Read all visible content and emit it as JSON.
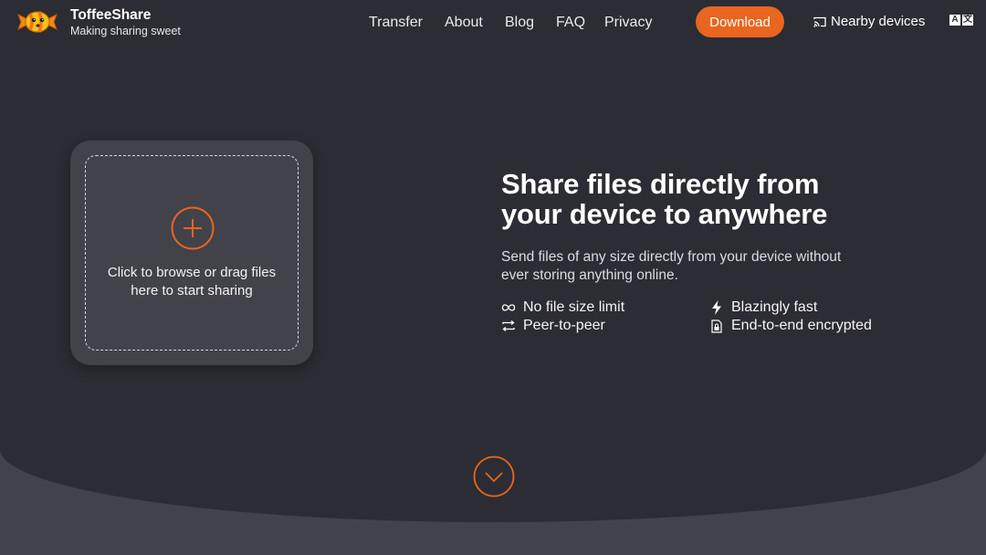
{
  "brand": {
    "name": "ToffeeShare",
    "tagline": "Making sharing sweet"
  },
  "nav": {
    "items": [
      {
        "label": "Transfer"
      },
      {
        "label": "About"
      },
      {
        "label": "Blog"
      },
      {
        "label": "FAQ"
      },
      {
        "label": "Privacy"
      }
    ],
    "download_label": "Download",
    "nearby_label": "Nearby devices",
    "language_icon": "translate-icon"
  },
  "dropzone": {
    "icon": "plus-circle-icon",
    "text": "Click to browse or drag files here to start sharing"
  },
  "hero": {
    "headline": "Share files directly from your device to anywhere",
    "subtext": "Send files of any size directly from your device without ever storing anything online.",
    "features": [
      {
        "icon": "infinity-icon",
        "label": "No file size limit"
      },
      {
        "icon": "lightning-icon",
        "label": "Blazingly fast"
      },
      {
        "icon": "swap-arrows-icon",
        "label": "Peer-to-peer"
      },
      {
        "icon": "encrypted-file-icon",
        "label": "End-to-end encrypted"
      }
    ]
  },
  "scroll": {
    "icon": "chevron-down-circle-icon"
  },
  "colors": {
    "accent": "#e8661f",
    "background": "#2c2c34",
    "card": "#42424a"
  }
}
